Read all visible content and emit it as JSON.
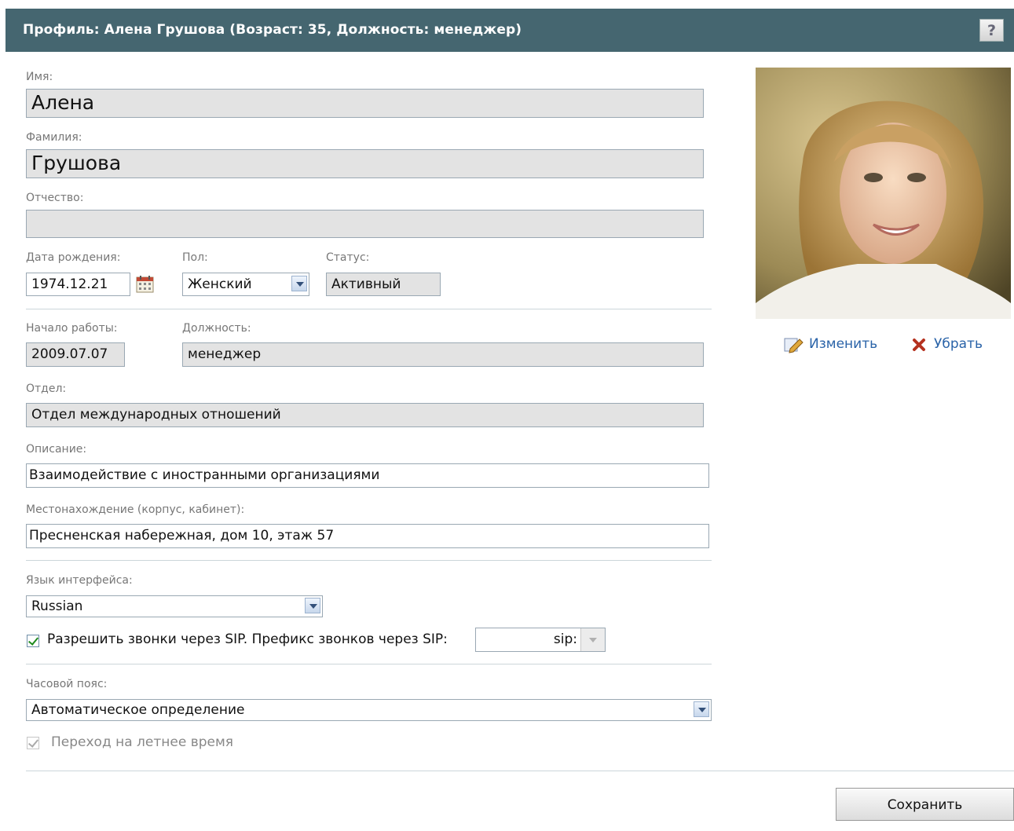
{
  "header": {
    "title": "Профиль: Алена Грушова (Возраст: 35, Должность: менеджер)",
    "help_label": "?"
  },
  "form": {
    "first_name": {
      "label": "Имя:",
      "value": "Алена"
    },
    "last_name": {
      "label": "Фамилия:",
      "value": "Грушова"
    },
    "middle_name": {
      "label": "Отчество:",
      "value": ""
    },
    "birth_date": {
      "label": "Дата рождения:",
      "value": "1974.12.21"
    },
    "gender": {
      "label": "Пол:",
      "value": "Женский"
    },
    "status": {
      "label": "Статус:",
      "value": "Активный"
    },
    "start_date": {
      "label": "Начало работы:",
      "value": "2009.07.07"
    },
    "position": {
      "label": "Должность:",
      "value": "менеджер"
    },
    "department": {
      "label": "Отдел:",
      "value": "Отдел международных отношений"
    },
    "description": {
      "label": "Описание:",
      "value": "Взаимодействие с иностранными организациями"
    },
    "location": {
      "label": "Местонахождение (корпус, кабинет):",
      "value": "Пресненская набережная, дом 10, этаж 57"
    },
    "language": {
      "label": "Язык интерфейса:",
      "value": "Russian"
    },
    "sip": {
      "checked": true,
      "label": "Разрешить звонки через SIP. Префикс звонков через SIP:",
      "prefix": "sip:"
    },
    "timezone": {
      "label": "Часовой пояс:",
      "value": "Автоматическое определение"
    },
    "dst": {
      "checked": true,
      "disabled": true,
      "label": "Переход на летнее время"
    }
  },
  "photo": {
    "edit_label": "Изменить",
    "remove_label": "Убрать"
  },
  "actions": {
    "save_label": "Сохранить"
  },
  "colors": {
    "header_bg": "#456670",
    "link": "#2a63a8",
    "readonly_field_bg": "#e3e3e3"
  }
}
